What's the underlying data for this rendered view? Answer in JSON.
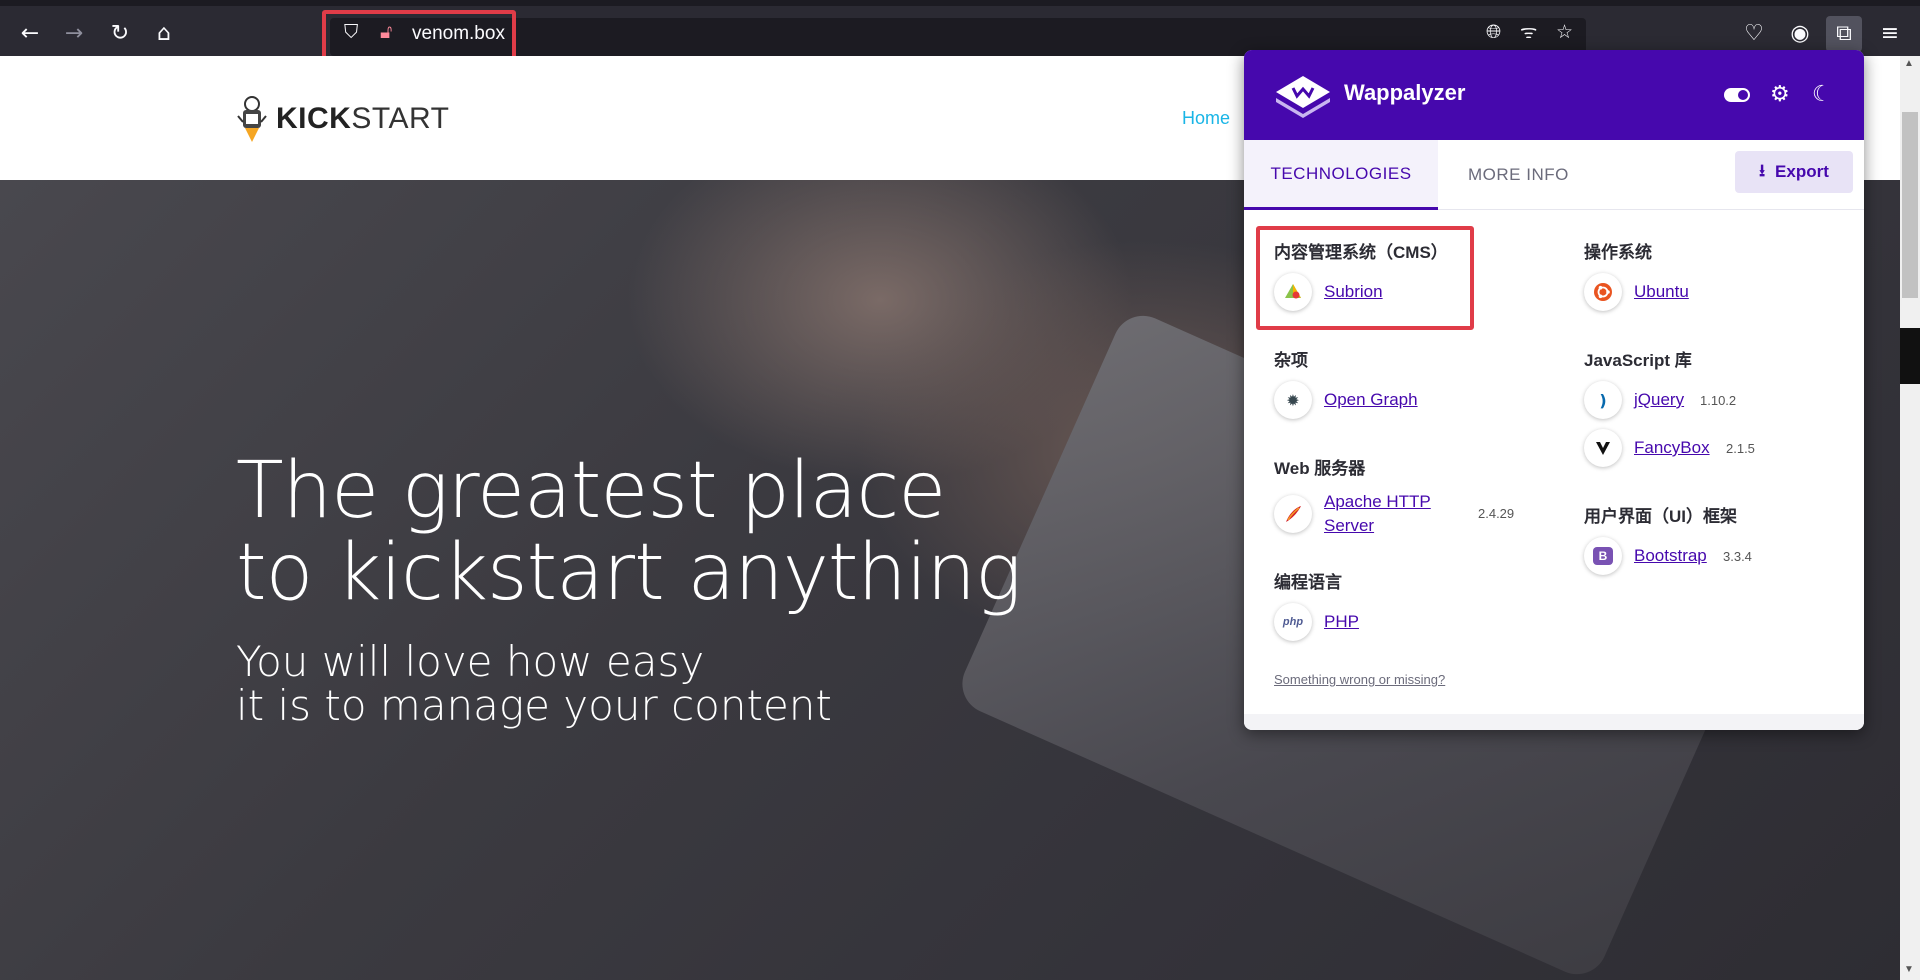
{
  "browser": {
    "url": "venom.box",
    "icons": {
      "back": "back-arrow-icon",
      "forward": "forward-arrow-icon",
      "reload": "reload-icon",
      "home": "home-icon",
      "shield": "shield-icon",
      "lock": "insecure-lock-icon",
      "globe": "globe-icon",
      "fingerprint": "fingerprint-icon",
      "bookmark": "star-icon",
      "pocket": "pocket-icon",
      "account": "account-icon",
      "extensions": "extensions-icon",
      "menu": "menu-icon"
    }
  },
  "site": {
    "logo_bold": "KICK",
    "logo_light": "START",
    "nav_home": "Home",
    "hero_line1": "The greatest place",
    "hero_line2": "to kickstart anything",
    "sub_line1": "You will love how easy",
    "sub_line2": "it is to manage your content"
  },
  "wappalyzer": {
    "title": "Wappalyzer",
    "tab_technologies": "TECHNOLOGIES",
    "tab_more_info": "MORE INFO",
    "export_label": "Export",
    "accent": "#4608ad",
    "left_column": [
      {
        "category": "内容管理系统（CMS）",
        "techs": [
          {
            "name": "Subrion",
            "version": "",
            "icon": "subrion-icon"
          }
        ]
      },
      {
        "category": "杂项",
        "techs": [
          {
            "name": "Open Graph",
            "version": "",
            "icon": "open-graph-icon"
          }
        ]
      },
      {
        "category": "Web 服务器",
        "techs": [
          {
            "name_line1": "Apache HTTP",
            "name_line2": "Server",
            "version": "2.4.29",
            "icon": "apache-feather-icon"
          }
        ]
      },
      {
        "category": "编程语言",
        "techs": [
          {
            "name": "PHP",
            "version": "",
            "icon": "php-icon"
          }
        ]
      }
    ],
    "right_column": [
      {
        "category": "操作系统",
        "techs": [
          {
            "name": "Ubuntu",
            "version": "",
            "icon": "ubuntu-icon"
          }
        ]
      },
      {
        "category": "JavaScript 库",
        "techs": [
          {
            "name": "jQuery",
            "version": "1.10.2",
            "icon": "jquery-icon"
          },
          {
            "name": "FancyBox",
            "version": "2.1.5",
            "icon": "fancybox-icon"
          }
        ]
      },
      {
        "category": "用户界面（UI）框架",
        "techs": [
          {
            "name": "Bootstrap",
            "version": "3.3.4",
            "icon": "bootstrap-icon"
          }
        ]
      }
    ],
    "footer_link": "Something wrong or missing?"
  }
}
